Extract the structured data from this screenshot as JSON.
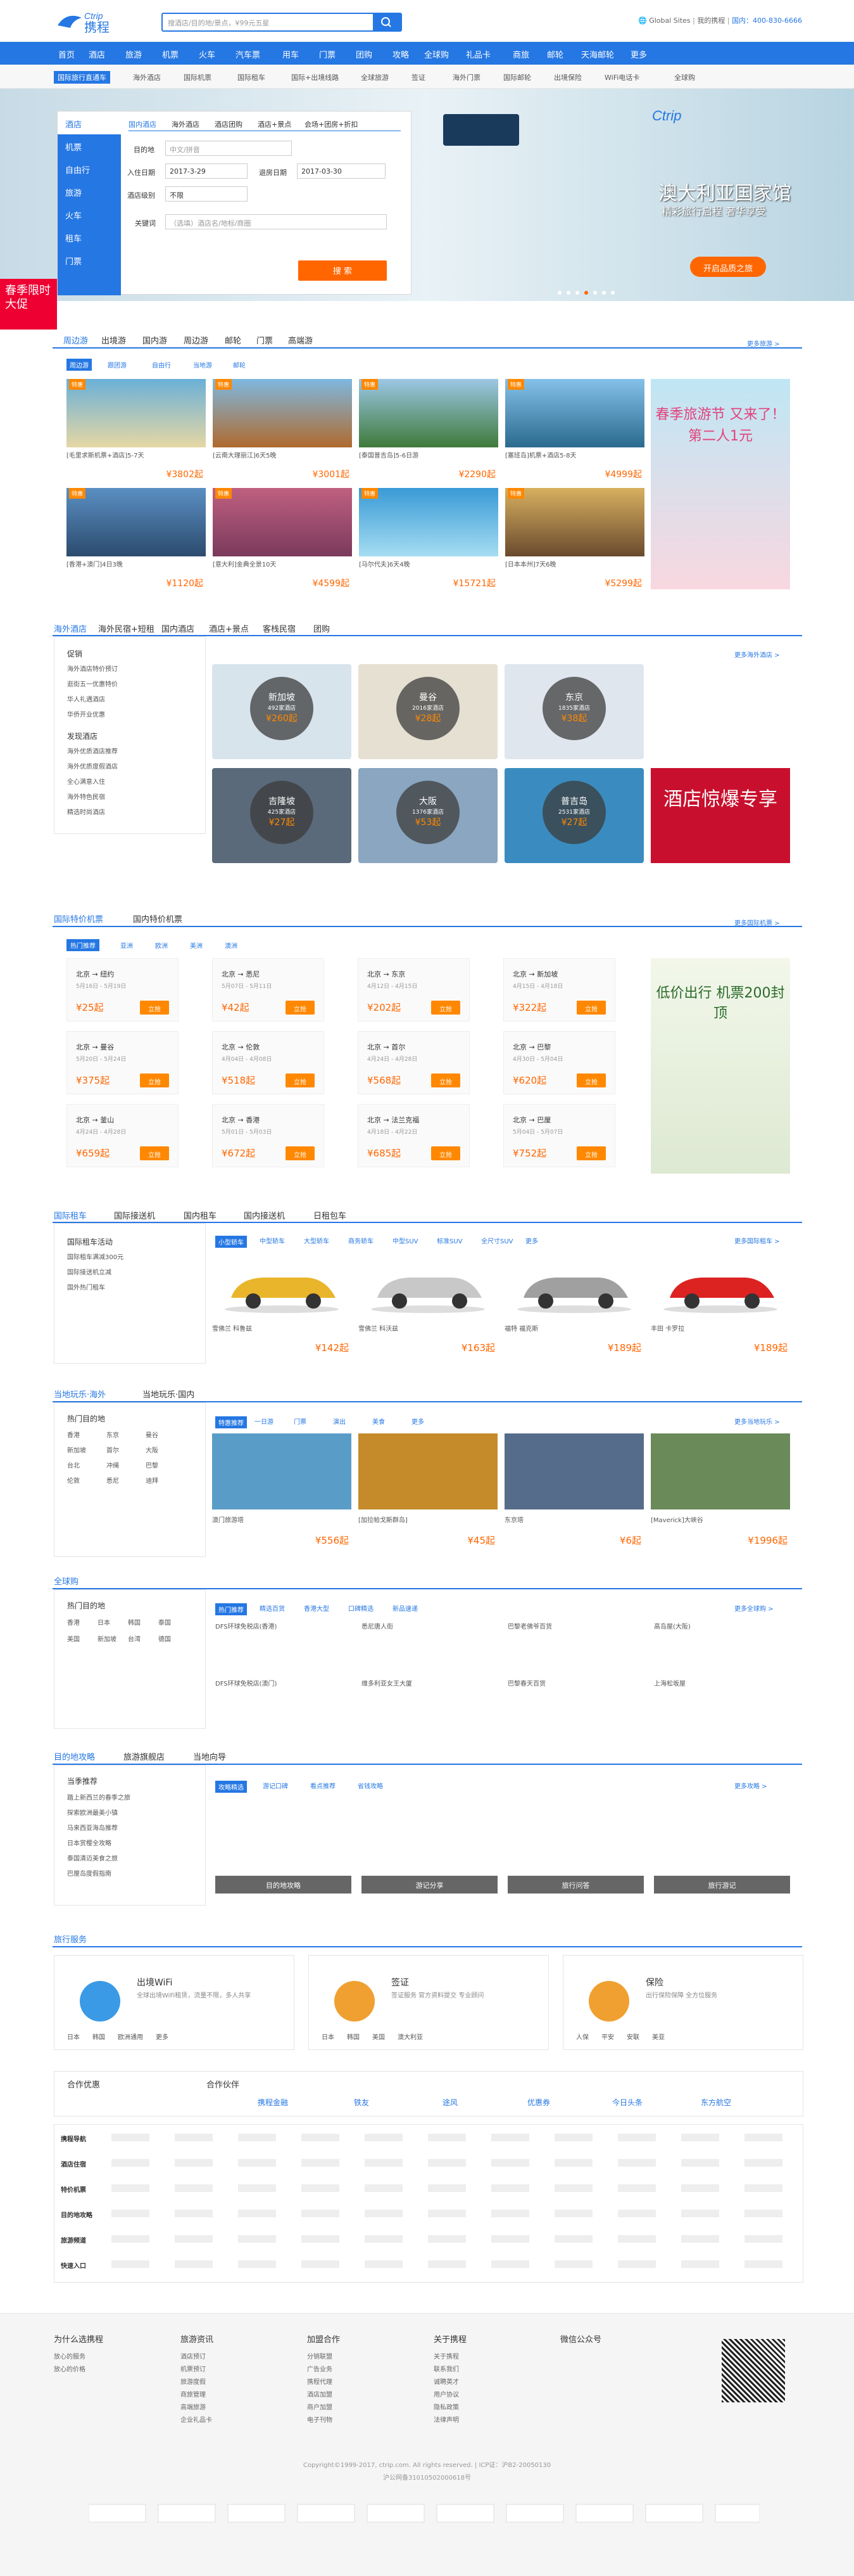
{
  "header": {
    "logo": "携程",
    "logo_en": "Ctrip",
    "search_placeholder": "搜酒店/目的地/景点，¥99元五星",
    "global": "Global Sites",
    "phone": "国内：400-830-6666",
    "links": [
      "我的携程",
      "登录",
      "注册"
    ]
  },
  "nav": [
    "首页",
    "酒店",
    "旅游",
    "机票",
    "火车",
    "汽车票",
    "用车",
    "门票",
    "团购",
    "攻略",
    "全球购",
    "礼品卡",
    "商旅",
    "邮轮",
    "天海邮轮",
    "更多"
  ],
  "subnav": [
    "国际旅行直通车",
    "海外酒店",
    "国际机票",
    "国际租车",
    "国际+出境线路",
    "全球旅游",
    "签证",
    "海外门票",
    "国际邮轮",
    "出境保险",
    "WiFi电话卡",
    "全球购"
  ],
  "hero": {
    "banner_title": "澳大利亚国家馆",
    "banner_sub": "精彩旅行启程 奢华享受",
    "banner_btn": "开启品质之旅",
    "promo": "春季限时大促"
  },
  "searchbox": {
    "tabs": [
      "酒店",
      "机票",
      "自由行",
      "旅游",
      "火车",
      "租车",
      "门票"
    ],
    "hotel_tabs": [
      "国内酒店",
      "海外酒店",
      "酒店团购",
      "酒店+景点",
      "会场+团房+折扣"
    ],
    "dest_label": "目的地",
    "dest_ph": "中文/拼音",
    "checkin_label": "入住日期",
    "checkin": "2017-3-29",
    "checkout_label": "退房日期",
    "checkout": "2017-03-30",
    "level_label": "酒店级别",
    "level": "不限",
    "kw_label": "关键词",
    "kw_ph": "（选填）酒店名/地标/商圈",
    "search": "搜 索"
  },
  "sec1": {
    "tabs": [
      "周边游",
      "出境游",
      "国内游",
      "周边游",
      "邮轮",
      "门票",
      "高端游"
    ],
    "sub": [
      "周边游",
      "跟团游",
      "自由行",
      "当地游",
      "邮轮"
    ],
    "more": "更多旅游 >",
    "cards": [
      {
        "t": "[毛里求斯机票+酒店]5-7天",
        "p": "3802"
      },
      {
        "t": "[云南大理丽江]6天5晚",
        "p": "3001"
      },
      {
        "t": "[泰国普吉岛]5-6日游",
        "p": "2290"
      },
      {
        "t": "[塞班岛]机票+酒店5-8天",
        "p": "4999"
      },
      {
        "t": "[香港+澳门]4日3晚",
        "p": "1120"
      },
      {
        "t": "[意大利]金典全景10天",
        "p": "4599"
      },
      {
        "t": "[马尔代夫]6天4晚",
        "p": "15721"
      },
      {
        "t": "[日本本州]7天6晚",
        "p": "5299"
      }
    ],
    "side": "春季旅游节 又来了！第二人1元"
  },
  "sec2": {
    "tabs": [
      "海外酒店",
      "海外民宿+短租",
      "国内酒店",
      "酒店+景点",
      "客栈民宿",
      "团购"
    ],
    "more": "更多海外酒店 >",
    "list_title": "促销",
    "list": [
      "海外酒店特价预订",
      "逛街五一优惠特价",
      "华人礼遇酒店",
      "华侨开业优惠"
    ],
    "list2_title": "发现酒店",
    "list2": [
      "海外优质酒店推荐",
      "海外优质度假酒店",
      "全心满意入住",
      "海外特色民宿",
      "精选时尚酒店",
      "精选度假村"
    ],
    "cities": [
      {
        "n": "新加坡",
        "c": "492家酒店",
        "p": "260"
      },
      {
        "n": "曼谷",
        "c": "2016家酒店",
        "p": "28"
      },
      {
        "n": "东京",
        "c": "1835家酒店",
        "p": "38"
      },
      {
        "n": "吉隆坡",
        "c": "425家酒店",
        "p": "27"
      },
      {
        "n": "大阪",
        "c": "1376家酒店",
        "p": "53"
      },
      {
        "n": "普吉岛",
        "c": "2531家酒店",
        "p": "27"
      }
    ],
    "side": "酒店惊爆专享"
  },
  "sec3": {
    "tabs": [
      "国际特价机票",
      "国内特价机票"
    ],
    "sub": [
      "热门推荐",
      "亚洲",
      "欧洲",
      "美洲",
      "澳洲"
    ],
    "more": "更多国际机票 >",
    "flights": [
      {
        "r": "北京 → 纽约",
        "d": "5月16日 - 5月19日",
        "p": "25"
      },
      {
        "r": "北京 → 悉尼",
        "d": "5月07日 - 5月11日",
        "p": "42"
      },
      {
        "r": "北京 → 东京",
        "d": "4月12日 - 4月15日",
        "p": "202"
      },
      {
        "r": "北京 → 新加坡",
        "d": "4月15日 - 4月18日",
        "p": "322"
      },
      {
        "r": "北京 → 曼谷",
        "d": "5月20日 - 5月24日",
        "p": "375"
      },
      {
        "r": "北京 → 伦敦",
        "d": "4月04日 - 4月08日",
        "p": "518"
      },
      {
        "r": "北京 → 首尔",
        "d": "4月24日 - 4月28日",
        "p": "568"
      },
      {
        "r": "北京 → 巴黎",
        "d": "4月30日 - 5月04日",
        "p": "620"
      },
      {
        "r": "北京 → 釜山",
        "d": "4月24日 - 4月28日",
        "p": "659"
      },
      {
        "r": "北京 → 香港",
        "d": "5月01日 - 5月03日",
        "p": "672"
      },
      {
        "r": "北京 → 法兰克福",
        "d": "4月18日 - 4月22日",
        "p": "685"
      },
      {
        "r": "北京 → 巴厘",
        "d": "5月04日 - 5月07日",
        "p": "752"
      }
    ],
    "btn": "立抢",
    "side": "低价出行 机票200封顶"
  },
  "sec4": {
    "tabs": [
      "国际租车",
      "国际接送机",
      "国内租车",
      "国内接送机",
      "日租包车"
    ],
    "types": [
      "小型轿车",
      "中型轿车",
      "大型轿车",
      "商务轿车",
      "中型SUV",
      "标准SUV",
      "全尺寸SUV",
      "更多"
    ],
    "more": "更多国际租车 >",
    "list_title": "国际租车活动",
    "list": [
      "国际租车满减300元",
      "国际接送机立减",
      "国外热门租车"
    ],
    "cars": [
      {
        "n": "雪佛兰 科鲁兹",
        "p": "142"
      },
      {
        "n": "雪佛兰 科沃兹",
        "p": "163"
      },
      {
        "n": "福特 福克斯",
        "p": "189"
      },
      {
        "n": "丰田 卡罗拉",
        "p": "189"
      }
    ]
  },
  "sec5": {
    "tabs": [
      "当地玩乐·海外",
      "当地玩乐·国内"
    ],
    "sub": [
      "特惠推荐",
      "一日游",
      "门票",
      "演出",
      "美食",
      "更多"
    ],
    "more": "更多当地玩乐 >",
    "list_title": "热门目的地",
    "cities": [
      "香港",
      "东京",
      "曼谷",
      "新加坡",
      "首尔",
      "大阪",
      "台北",
      "冲绳",
      "巴黎",
      "伦敦",
      "悉尼",
      "迪拜"
    ],
    "items": [
      {
        "t": "澳门旅游塔",
        "p": "556"
      },
      {
        "t": "[加拉帕戈斯群岛]",
        "p": "45"
      },
      {
        "t": "东京塔",
        "p": "6"
      },
      {
        "t": "[Maverick]大峡谷",
        "p": "1996"
      }
    ]
  },
  "sec6": {
    "title": "全球购",
    "sub": [
      "热门推荐",
      "精选百货",
      "香港大型",
      "口碑精选",
      "新品速递"
    ],
    "more": "更多全球购 >",
    "list_title": "热门目的地",
    "cities": [
      "香港",
      "日本",
      "韩国",
      "泰国",
      "美国",
      "新加坡",
      "台湾",
      "德国"
    ],
    "items": [
      "DFS环球免税店(香港)",
      "悉尼唐人街",
      "巴黎老佛爷百货",
      "高岛屋(大阪)",
      "DFS环球免税店(澳门)",
      "维多利亚女王大厦",
      "巴黎春天百货",
      "上海松坂屋"
    ]
  },
  "sec7": {
    "tabs": [
      "目的地攻略",
      "旅游旗舰店",
      "当地向导"
    ],
    "sub": [
      "攻略精选",
      "游记口碑",
      "看点推荐",
      "省钱攻略"
    ],
    "more": "更多攻略 >",
    "list_title": "当季推荐",
    "list": [
      "踏上新西兰的春季之旅",
      "探索欧洲最美小镇",
      "马来西亚海岛推荐",
      "日本赏樱全攻略",
      "泰国清迈美食之旅",
      "巴厘岛度假指南"
    ],
    "btns": [
      "目的地攻略",
      "游记分享",
      "旅行问答",
      "旅行游记"
    ]
  },
  "services": {
    "title": "旅行服务",
    "items": [
      {
        "n": "出境WiFi",
        "d": "全球出境WiFi租赁，流量不限，多人共享",
        "chips": [
          "日本",
          "韩国",
          "欧洲通用",
          "更多"
        ]
      },
      {
        "n": "签证",
        "d": "签证服务 官方资料提交 专业顾问",
        "chips": [
          "日本",
          "韩国",
          "美国",
          "澳大利亚"
        ]
      },
      {
        "n": "保险",
        "d": "出行保险保障 全方位服务",
        "chips": [
          "人保",
          "平安",
          "安联",
          "美亚"
        ]
      }
    ]
  },
  "partners": {
    "title": "合作优惠",
    "partners_title": "合作伙伴",
    "logos": [
      "携程金融",
      "铁友",
      "途风",
      "优惠券",
      "今日头条",
      "东方航空"
    ]
  },
  "links": {
    "rows": [
      "携程导航",
      "酒店住宿",
      "特价机票",
      "目的地攻略",
      "旅游频道",
      "快速入口"
    ]
  },
  "footer": {
    "cols": [
      {
        "h": "为什么选携程",
        "li": [
          "放心的服务",
          "放心的价格"
        ]
      },
      {
        "h": "旅游资讯",
        "li": [
          "酒店预订",
          "机票预订",
          "旅游度假",
          "商旅管理",
          "高端旅游",
          "企业礼品卡"
        ]
      },
      {
        "h": "加盟合作",
        "li": [
          "分销联盟",
          "广告业务",
          "携程代理",
          "酒店加盟",
          "商户加盟",
          "电子刊物"
        ]
      },
      {
        "h": "关于携程",
        "li": [
          "关于携程",
          "联系我们",
          "诚聘英才",
          "用户协议",
          "隐私政策",
          "法律声明"
        ]
      },
      {
        "h": "微信公众号",
        "li": []
      }
    ],
    "copy": "Copyright©1999-2017, ctrip.com. All rights reserved. | ICP证：沪B2-20050130",
    "icp": "沪公网备31010502000618号"
  }
}
